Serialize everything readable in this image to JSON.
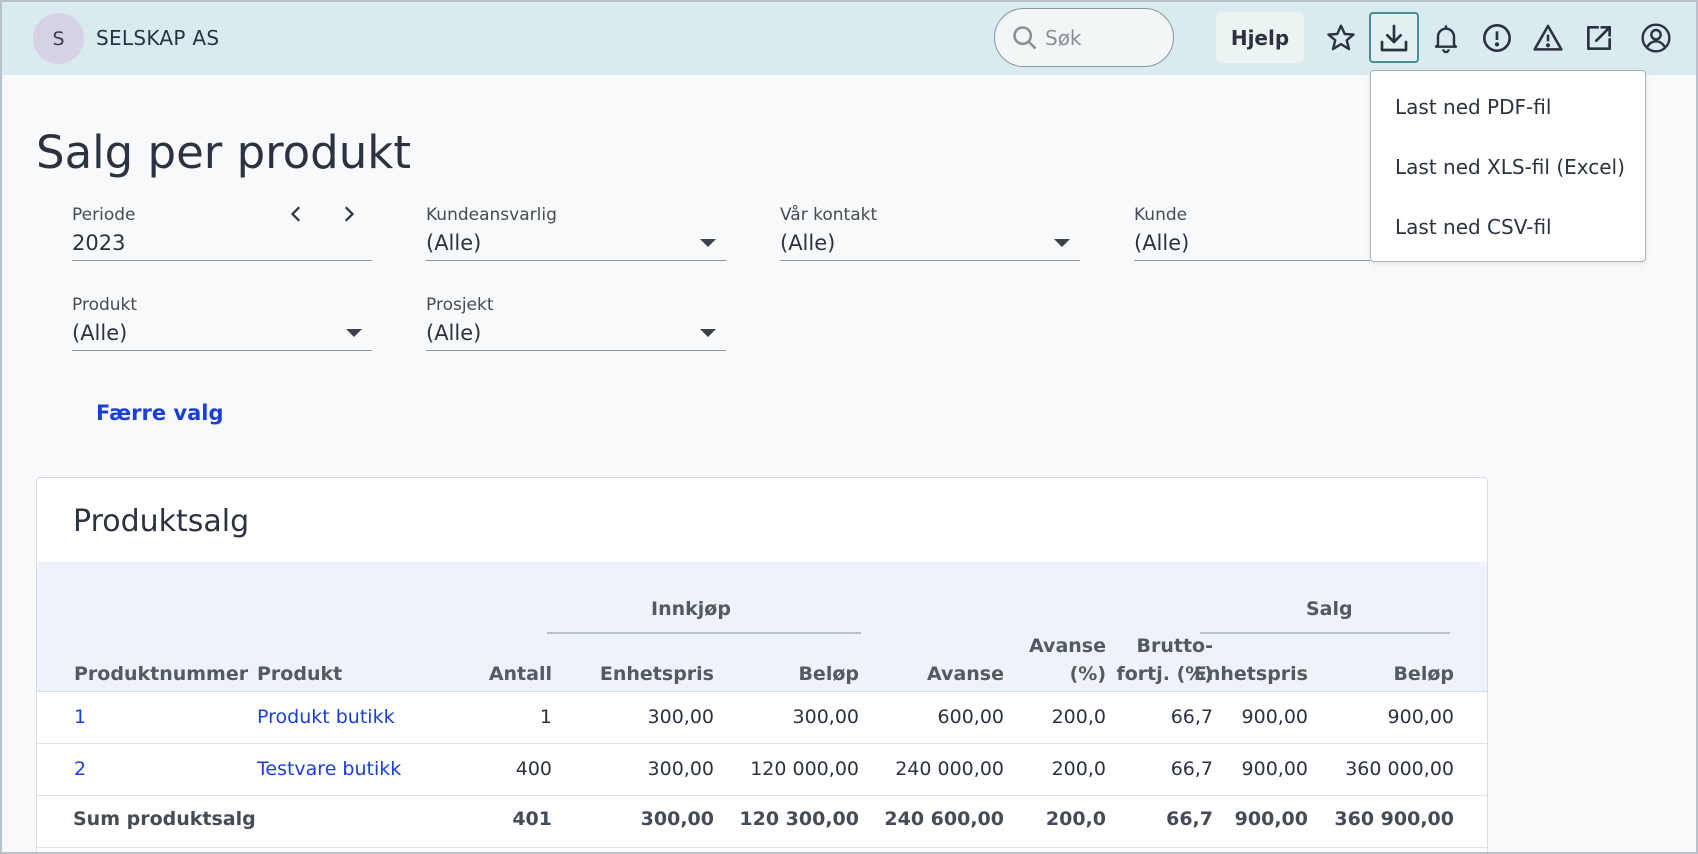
{
  "header": {
    "avatar_initial": "S",
    "company": "SELSKAP AS",
    "search_placeholder": "Søk",
    "help_label": "Hjelp",
    "icons": [
      "star-icon",
      "download-icon",
      "bell-icon",
      "alert-circle-icon",
      "warning-icon",
      "external-link-icon",
      "user-icon"
    ]
  },
  "download_menu": {
    "items": [
      "Last ned PDF-fil",
      "Last ned XLS-fil (Excel)",
      "Last ned CSV-fil"
    ]
  },
  "page_title": "Salg per produkt",
  "filters": {
    "periode": {
      "label": "Periode",
      "value": "2023"
    },
    "kundeansvarlig": {
      "label": "Kundeansvarlig",
      "value": "(Alle)"
    },
    "var_kontakt": {
      "label": "Vår kontakt",
      "value": "(Alle)"
    },
    "kunde": {
      "label": "Kunde",
      "value": "(Alle)"
    },
    "produkt": {
      "label": "Produkt",
      "value": "(Alle)"
    },
    "prosjekt": {
      "label": "Prosjekt",
      "value": "(Alle)"
    }
  },
  "fewer_options": "Færre valg",
  "table": {
    "title": "Produktsalg",
    "group_headers": {
      "innkjop": "Innkjøp",
      "salg": "Salg"
    },
    "columns": {
      "produktnummer": "Produktnummer",
      "produkt": "Produkt",
      "antall": "Antall",
      "innkjop_enhetspris": "Enhetspris",
      "innkjop_belop": "Beløp",
      "avanse": "Avanse",
      "avanse_pct_1": "Avanse",
      "avanse_pct_2": "(%)",
      "brutto_1": "Brutto-",
      "brutto_2": "fortj. (%)",
      "salg_enhetspris": "Enhetspris",
      "salg_belop": "Beløp"
    },
    "rows": [
      {
        "nr": "1",
        "produkt": "Produkt butikk",
        "antall": "1",
        "i_enh": "300,00",
        "i_bel": "300,00",
        "avanse": "600,00",
        "avanse_pct": "200,0",
        "brutto": "66,7",
        "s_enh": "900,00",
        "s_bel": "900,00"
      },
      {
        "nr": "2",
        "produkt": "Testvare butikk",
        "antall": "400",
        "i_enh": "300,00",
        "i_bel": "120 000,00",
        "avanse": "240 000,00",
        "avanse_pct": "200,0",
        "brutto": "66,7",
        "s_enh": "900,00",
        "s_bel": "360 000,00"
      }
    ],
    "sum": {
      "label": "Sum produktsalg",
      "antall": "401",
      "i_enh": "300,00",
      "i_bel": "120 300,00",
      "avanse": "240 600,00",
      "avanse_pct": "200,0",
      "brutto": "66,7",
      "s_enh": "900,00",
      "s_bel": "360 900,00"
    }
  }
}
